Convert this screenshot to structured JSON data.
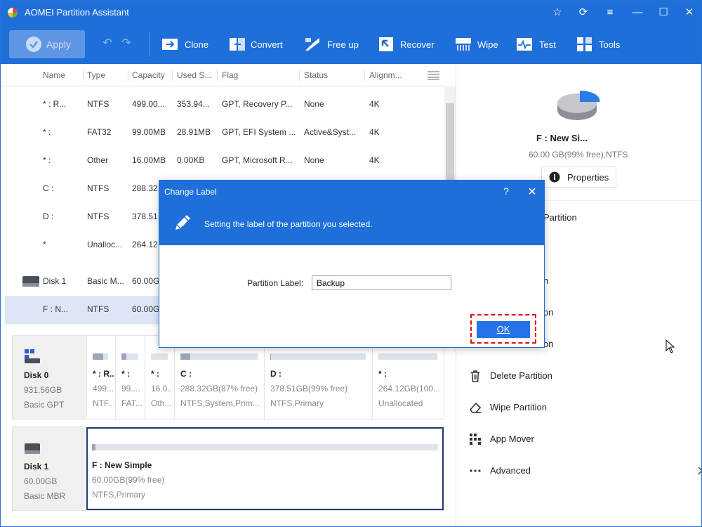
{
  "app": {
    "title": "AOMEI Partition Assistant",
    "accent": "#1e6fd9"
  },
  "toolbar": {
    "apply_label": "Apply",
    "tools": [
      {
        "label": "Clone",
        "icon": "clone-icon"
      },
      {
        "label": "Convert",
        "icon": "convert-icon"
      },
      {
        "label": "Free up",
        "icon": "free-up-icon"
      },
      {
        "label": "Recover",
        "icon": "recover-icon"
      },
      {
        "label": "Wipe",
        "icon": "wipe-icon"
      },
      {
        "label": "Test",
        "icon": "test-icon"
      },
      {
        "label": "Tools",
        "icon": "tools-icon"
      }
    ]
  },
  "table": {
    "columns": [
      "Name",
      "Type",
      "Capacity",
      "Used S...",
      "Flag",
      "Status",
      "Alignm..."
    ],
    "rows": [
      {
        "name": "* : R...",
        "type": "NTFS",
        "capacity": "499.00...",
        "used": "353.94...",
        "flag": "GPT, Recovery P...",
        "status": "None",
        "align": "4K"
      },
      {
        "name": "* :",
        "type": "FAT32",
        "capacity": "99.00MB",
        "used": "28.91MB",
        "flag": "GPT, EFI System ...",
        "status": "Active&Syst...",
        "align": "4K"
      },
      {
        "name": "* :",
        "type": "Other",
        "capacity": "16.00MB",
        "used": "0.00KB",
        "flag": "GPT, Microsoft R...",
        "status": "None",
        "align": "4K"
      },
      {
        "name": "C :",
        "type": "NTFS",
        "capacity": "288.32",
        "used": "",
        "flag": "",
        "status": "",
        "align": ""
      },
      {
        "name": "D :",
        "type": "NTFS",
        "capacity": "378.51",
        "used": "",
        "flag": "",
        "status": "",
        "align": ""
      },
      {
        "name": "*",
        "type": "Unalloc...",
        "capacity": "264.12",
        "used": "",
        "flag": "",
        "status": "",
        "align": ""
      },
      {
        "name": "Disk 1",
        "type": "Basic M...",
        "capacity": "60.00G",
        "used": "",
        "flag": "",
        "status": "",
        "align": ""
      },
      {
        "name": "F : N...",
        "type": "NTFS",
        "capacity": "60.00G",
        "used": "",
        "flag": "",
        "status": "",
        "align": ""
      }
    ]
  },
  "diskmap": {
    "disk0": {
      "name": "Disk 0",
      "size": "931.56GB",
      "style": "Basic GPT",
      "partitions": [
        {
          "name": "* : R...",
          "size": "499...",
          "fs": "NTF...",
          "fill": 0.7
        },
        {
          "name": "* :",
          "size": "99....",
          "fs": "FAT...",
          "fill": 0.3
        },
        {
          "name": "* :",
          "size": "16.0...",
          "fs": "Oth...",
          "fill": 0.0
        },
        {
          "name": "C :",
          "size": "288.32GB(87% free)",
          "fs": "NTFS,System,Prim...",
          "fill": 0.13
        },
        {
          "name": "D :",
          "size": "378.51GB(99% free)",
          "fs": "NTFS,Primary",
          "fill": 0.01
        },
        {
          "name": "* :",
          "size": "264.12GB(100...",
          "fs": "Unallocated",
          "fill": 0.0
        }
      ]
    },
    "disk1": {
      "name": "Disk 1",
      "size": "60.00GB",
      "style": "Basic MBR",
      "partition": {
        "name": "F : New Simple",
        "size": "60.00GB(99% free)",
        "fs": "NTFS,Primary",
        "fill": 0.01
      }
    }
  },
  "right_panel": {
    "partition_name": "F : New Si...",
    "partition_info": "60.00 GB(99% free),NTFS",
    "properties_label": "Properties",
    "operations": [
      {
        "label": "Partition",
        "icon": "resize-icon"
      },
      {
        "label": "n",
        "icon": "merge-icon"
      },
      {
        "label": "on",
        "icon": "split-icon"
      },
      {
        "label": "on",
        "icon": "allocate-icon"
      },
      {
        "label": "Delete Partition",
        "icon": "trash-icon"
      },
      {
        "label": "Wipe Partition",
        "icon": "eraser-icon"
      },
      {
        "label": "App Mover",
        "icon": "app-mover-icon"
      },
      {
        "label": "Advanced",
        "icon": "more-icon"
      }
    ]
  },
  "dialog": {
    "title": "Change Label",
    "help": "?",
    "close": "✕",
    "description": "Setting the label of the partition you selected.",
    "field_label": "Partition Label:",
    "field_value": "Backup",
    "ok_label": "OK"
  }
}
